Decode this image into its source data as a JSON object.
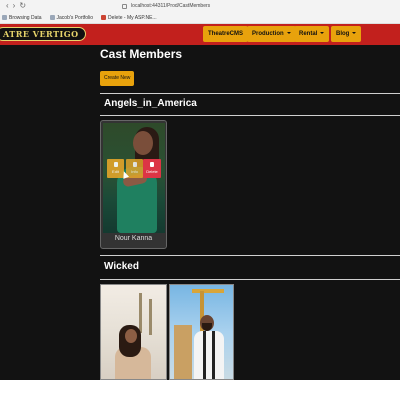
{
  "browser": {
    "url": "localhost:44311/Prod/CastMembers",
    "bookmarks": [
      {
        "label": "Browsing Data"
      },
      {
        "label": "Jacob's Portfolio"
      },
      {
        "label": "Delete - My ASP.NE..."
      }
    ]
  },
  "header": {
    "logo_text": "ATRE VERTIGO",
    "nav": [
      {
        "label": "TheatreCMS",
        "dropdown": false
      },
      {
        "label": "Production",
        "dropdown": true
      },
      {
        "label": "Rental",
        "dropdown": true
      },
      {
        "label": "Blog",
        "dropdown": true
      }
    ]
  },
  "page": {
    "title": "Cast Members",
    "create_label": "Create New"
  },
  "sections": [
    {
      "title": "Angels_in_America",
      "cards": [
        {
          "name": "Nour Kanna",
          "actions": {
            "edit": "Edit",
            "details": "Info",
            "delete": "Delete"
          }
        }
      ]
    },
    {
      "title": "Wicked",
      "cards": []
    }
  ],
  "colors": {
    "header_bg": "#c2201d",
    "accent": "#e8a20c",
    "delete": "#dc3545",
    "page_bg": "#121212"
  }
}
